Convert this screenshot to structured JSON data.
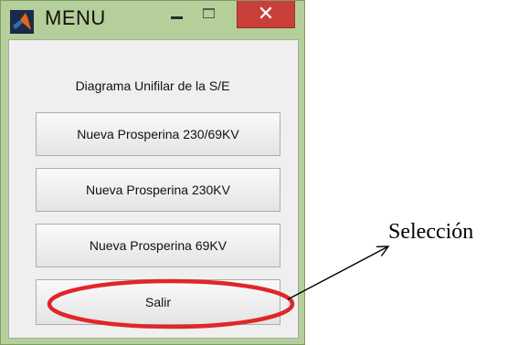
{
  "window": {
    "title": "MENU",
    "frame_color": "#b5cf9a",
    "close_color": "#c9403a",
    "controls": {
      "minimize_icon": "minimize-icon",
      "maximize_icon": "maximize-icon",
      "close_icon": "close-icon",
      "close_glyph": "✕"
    }
  },
  "panel": {
    "heading": "Diagrama Unifilar de la S/E",
    "buttons": [
      {
        "label": "Nueva Prosperina 230/69KV"
      },
      {
        "label": "Nueva Prosperina 230KV"
      },
      {
        "label": "Nueva Prosperina 69KV"
      },
      {
        "label": "Salir"
      }
    ]
  },
  "annotation": {
    "label": "Selección",
    "highlight_color": "#e0262a"
  }
}
